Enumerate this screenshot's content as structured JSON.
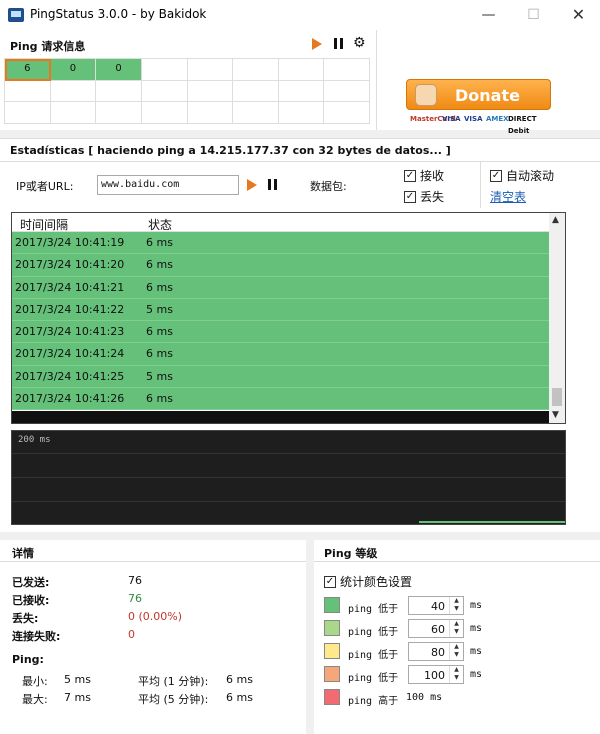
{
  "window": {
    "title": "PingStatus 3.0.0 - by Bakidok",
    "min": "—",
    "max": "☐",
    "close": "✕"
  },
  "ping_info": {
    "title": "Ping 请求信息",
    "cells": [
      "6",
      "0",
      "0"
    ]
  },
  "donate": {
    "label": "Donate",
    "cards": [
      "MasterCard",
      "VISA",
      "VISA",
      "AMEX",
      "DIRECT Debit"
    ]
  },
  "stats": {
    "text": "Estadísticas  [ haciendo ping a 14.215.177.37 con 32 bytes de datos... ]"
  },
  "controls": {
    "ip_label": "IP或者URL:",
    "url_value": "www.baidu.com",
    "packet_label": "数据包:",
    "received_label": "接收",
    "lost_label": "丢失",
    "autoscroll_label": "自动滚动",
    "clear_link": "清空表",
    "check_mark": "✓"
  },
  "log": {
    "col_time": "时间间隔",
    "col_status": "状态",
    "rows": [
      {
        "time": "2017/3/24  10:41:19",
        "status": "6 ms"
      },
      {
        "time": "2017/3/24  10:41:20",
        "status": "6 ms"
      },
      {
        "time": "2017/3/24  10:41:21",
        "status": "6 ms"
      },
      {
        "time": "2017/3/24  10:41:22",
        "status": "5 ms"
      },
      {
        "time": "2017/3/24  10:41:23",
        "status": "6 ms"
      },
      {
        "time": "2017/3/24  10:41:24",
        "status": "6 ms"
      },
      {
        "time": "2017/3/24  10:41:25",
        "status": "5 ms"
      },
      {
        "time": "2017/3/24  10:41:26",
        "status": "6 ms"
      }
    ],
    "scroll_up": "▲",
    "scroll_down": "▼"
  },
  "graph": {
    "label": "200 ms"
  },
  "details": {
    "title": "详情",
    "sent_label": "已发送:",
    "sent_value": "76",
    "received_label": "已接收:",
    "received_value": "76",
    "lost_label": "丢失:",
    "lost_value": "0  (0.00%)",
    "failed_label": "连接失败:",
    "failed_value": "0",
    "ping_label": "Ping:",
    "min_label": "最小:",
    "min_value": "5 ms",
    "max_label": "最大:",
    "max_value": "7 ms",
    "avg1_label": "平均 (1 分钟):",
    "avg1_value": "6 ms",
    "avg5_label": "平均 (5 分钟):",
    "avg5_value": "6 ms"
  },
  "levels": {
    "title": "Ping 等级",
    "color_setting_label": "统计颜色设置",
    "rows": [
      {
        "label": "ping 低于",
        "value": "40",
        "unit": "ms",
        "color": "#65c07a"
      },
      {
        "label": "ping 低于",
        "value": "60",
        "unit": "ms",
        "color": "#a9d88a"
      },
      {
        "label": "ping 低于",
        "value": "80",
        "unit": "ms",
        "color": "#ffe98a"
      },
      {
        "label": "ping 低于",
        "value": "100",
        "unit": "ms",
        "color": "#f6a77a"
      }
    ],
    "high_label": "ping 高于",
    "high_value": "100 ms",
    "high_color": "#f26a72"
  },
  "colors": {
    "accent": "#e8781e",
    "ok": "#65c07a",
    "link": "#1a5fb4"
  }
}
